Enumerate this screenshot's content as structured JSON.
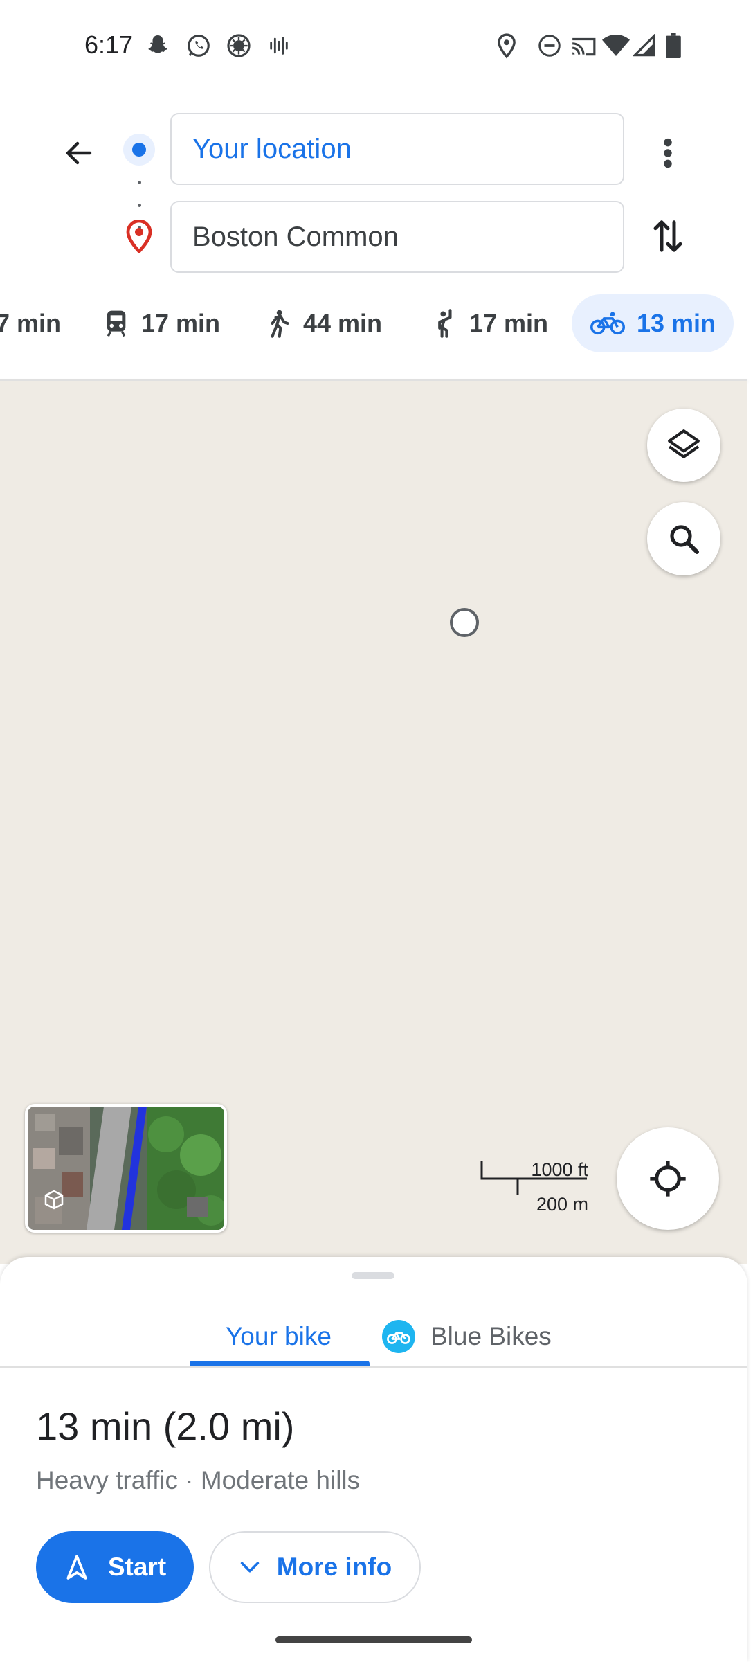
{
  "status_bar": {
    "time": "6:17",
    "left_icons": [
      "snapchat-icon",
      "whatsapp-icon",
      "app-icon",
      "voice-icon"
    ],
    "right_icons": [
      "location-icon",
      "do-not-disturb-icon",
      "cast-icon",
      "wifi-icon",
      "signal-icon",
      "battery-icon"
    ]
  },
  "directions": {
    "origin": "Your location",
    "destination": "Boston Common"
  },
  "modes": [
    {
      "name": "drive",
      "icon": "car-icon",
      "label": "7 min"
    },
    {
      "name": "transit",
      "icon": "train-icon",
      "label": "17 min"
    },
    {
      "name": "walk",
      "icon": "walk-icon",
      "label": "44 min"
    },
    {
      "name": "rideshare",
      "icon": "hail-icon",
      "label": "17 min"
    },
    {
      "name": "bike",
      "icon": "bike-icon",
      "label": "13 min",
      "selected": true
    }
  ],
  "map": {
    "scale_ft": "1000 ft",
    "scale_m": "200 m",
    "background": "#efebe4"
  },
  "sheet": {
    "tabs": [
      "Your bike",
      "Blue Bikes"
    ],
    "active_tab": "Your bike",
    "duration": "13 min (2.0 mi)",
    "details": "Heavy traffic · Moderate hills",
    "start_label": "Start",
    "more_info_label": "More info"
  },
  "colors": {
    "accent": "#1a73e8",
    "accent_light": "#e8f0fe",
    "destination_pin": "#d93025",
    "blue_bikes": "#1eb5f0"
  }
}
